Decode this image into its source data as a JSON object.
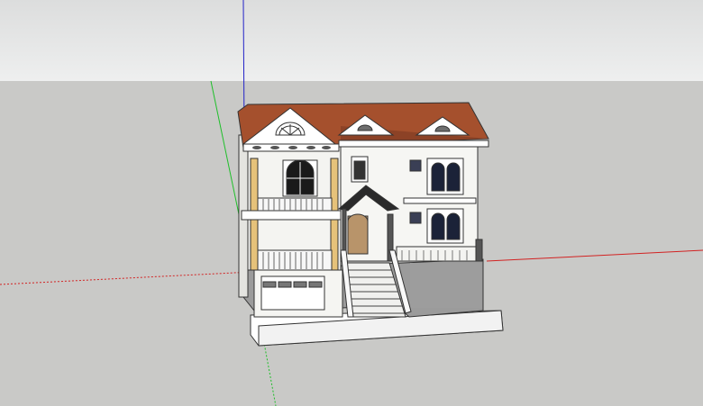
{
  "viewport": {
    "sky_color": "#e6e7e7",
    "ground_color": "#c9c9c7",
    "axis_colors": {
      "red": "#d22222",
      "green": "#1fbf2a",
      "blue": "#2323c8"
    }
  },
  "model": {
    "roof_color": "#a5502d",
    "wall_color": "#f4f4f1",
    "column_color": "#e6c27a",
    "base_color": "#9a9a9a",
    "trim_color": "#333333"
  },
  "icons": {
    "orbit": "orbit-icon",
    "axes": "axes-icon"
  }
}
